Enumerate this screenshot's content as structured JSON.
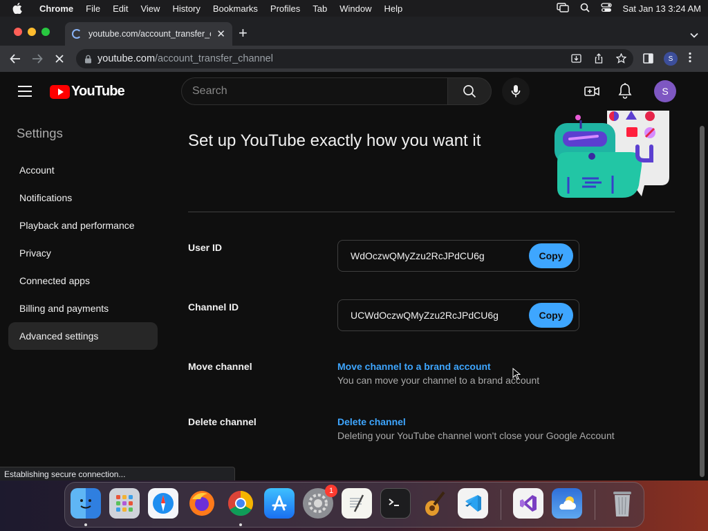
{
  "menubar": {
    "app_name": "Chrome",
    "items": [
      "File",
      "Edit",
      "View",
      "History",
      "Bookmarks",
      "Profiles",
      "Tab",
      "Window",
      "Help"
    ],
    "clock": "Sat Jan 13  3:24 AM"
  },
  "browser": {
    "tab_title": "youtube.com/account_transfer_channel",
    "url_host": "youtube.com",
    "url_path": "/account_transfer_channel",
    "profile_initial": "S",
    "status_text": "Establishing secure connection..."
  },
  "masthead": {
    "logo_text": "YouTube",
    "search_placeholder": "Search",
    "avatar_initial": "S"
  },
  "sidebar": {
    "heading": "Settings",
    "items": [
      {
        "label": "Account"
      },
      {
        "label": "Notifications"
      },
      {
        "label": "Playback and performance"
      },
      {
        "label": "Privacy"
      },
      {
        "label": "Connected apps"
      },
      {
        "label": "Billing and payments"
      },
      {
        "label": "Advanced settings"
      }
    ],
    "active_index": 6
  },
  "main": {
    "heading": "Set up YouTube exactly how you want it",
    "user_id": {
      "label": "User ID",
      "value": "WdOczwQMyZzu2RcJPdCU6g",
      "button": "Copy"
    },
    "channel_id": {
      "label": "Channel ID",
      "value": "UCWdOczwQMyZzu2RcJPdCU6g",
      "button": "Copy"
    },
    "move_channel": {
      "label": "Move channel",
      "link": "Move channel to a brand account",
      "desc": "You can move your channel to a brand account"
    },
    "delete_channel": {
      "label": "Delete channel",
      "link": "Delete channel",
      "desc": "Deleting your YouTube channel won't close your Google Account"
    }
  },
  "dock": {
    "apps": [
      "Finder",
      "Launchpad",
      "Safari",
      "Firefox",
      "Chrome",
      "App Store",
      "System Settings",
      "TextEdit",
      "Terminal",
      "GarageBand",
      "Visual Studio Code",
      "Visual Studio",
      "Weather",
      "Trash"
    ],
    "system_settings_badge": "1"
  },
  "colors": {
    "accent_blue": "#3ea6ff",
    "youtube_red": "#ff0000",
    "background": "#0f0f0f"
  }
}
